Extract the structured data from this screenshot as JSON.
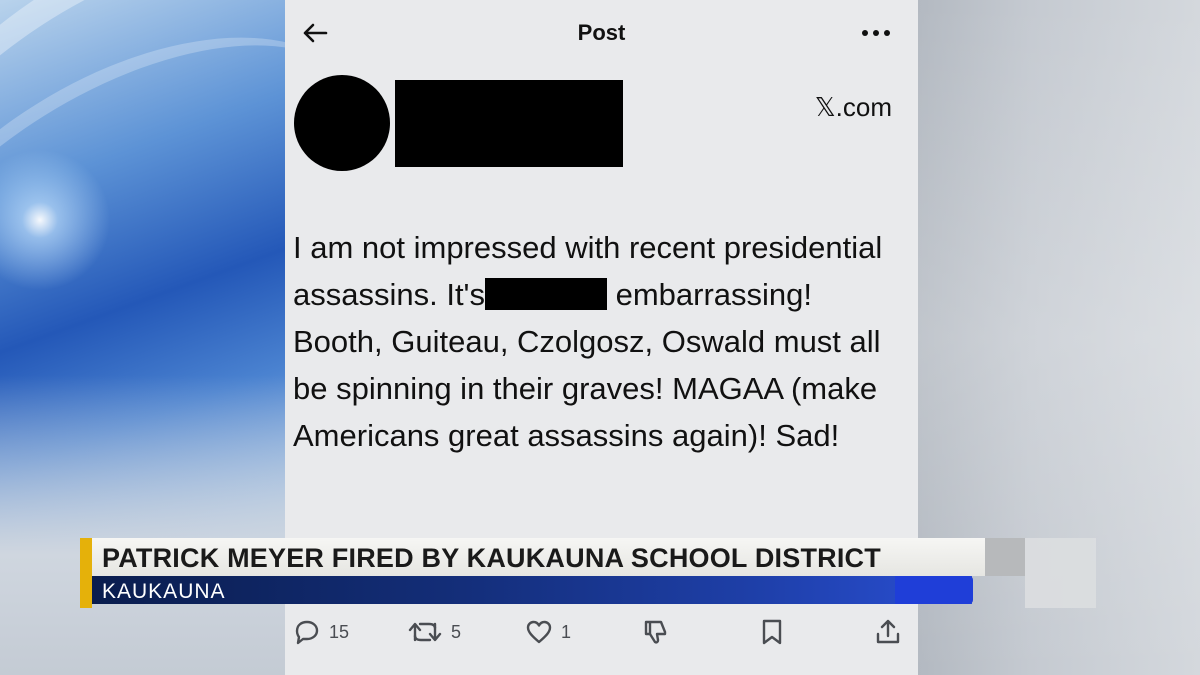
{
  "post": {
    "header_title": "Post",
    "source": "𝕏.com",
    "text_before_redaction": "I am not impressed with recent presidential assassins.  It's",
    "text_after_redaction": " embarrassing!  Booth, Guiteau, Czolgosz, Oswald must all be spinning in their graves!  MAGAA (make Americans great assassins again)!  Sad!",
    "actions": {
      "replies": "15",
      "reposts": "5",
      "likes": "1"
    }
  },
  "icons": [
    "back-arrow-icon",
    "more-icon",
    "reply-icon",
    "repost-icon",
    "like-icon",
    "dislike-icon",
    "bookmark-icon",
    "share-icon"
  ],
  "lower_third": {
    "headline": "PATRICK MEYER FIRED BY KAUKAUNA SCHOOL DISTRICT",
    "location": "KAUKAUNA",
    "accent_color": "#e5b10a",
    "bar_color": "#1e3fa8"
  }
}
